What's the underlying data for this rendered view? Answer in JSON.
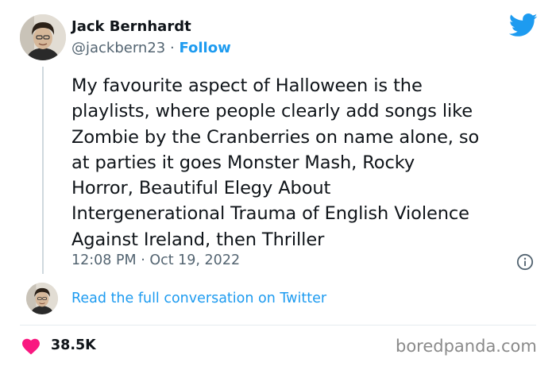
{
  "author": {
    "name": "Jack Bernhardt",
    "handle": "@jackbern23",
    "separator": "·",
    "follow_label": "Follow"
  },
  "tweet": {
    "text": "My favourite aspect of Halloween is the\nplaylists, where people clearly add songs like\nZombie by the Cranberries on name alone, so\nat parties it goes Monster Mash, Rocky\nHorror, Beautiful Elegy About\nIntergenerational Trauma of English Violence\nAgainst Ireland, then Thriller",
    "timestamp": "12:08 PM · Oct 19, 2022"
  },
  "conversation": {
    "link_label": "Read the full conversation on Twitter"
  },
  "engagement": {
    "likes": "38.5K"
  },
  "watermark": "boredpanda.com",
  "icons": {
    "brand": "twitter-bird-icon",
    "info": "info-icon",
    "like": "heart-icon"
  },
  "colors": {
    "twitter_blue": "#1d9bf0",
    "heart": "#f91880",
    "secondary_text": "#536471"
  }
}
